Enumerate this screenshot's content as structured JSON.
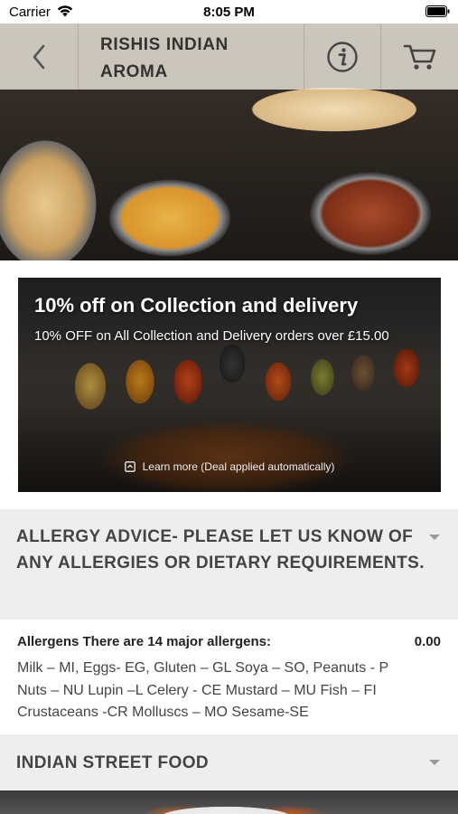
{
  "status_bar": {
    "carrier": "Carrier",
    "time": "8:05 PM"
  },
  "header": {
    "title": "RISHIS INDIAN AROMA"
  },
  "promo": {
    "title": "10% off on Collection and delivery",
    "description": "10% OFF on All Collection and Delivery orders over £15.00",
    "learn_more": "Learn more (Deal applied automatically)"
  },
  "categories": [
    {
      "title": "ALLERGY ADVICE- PLEASE LET US KNOW OF ANY ALLERGIES OR DIETARY REQUIREMENTS."
    },
    {
      "title": "INDIAN STREET FOOD"
    }
  ],
  "menu_item": {
    "name": "Allergens There are 14 major allergens:",
    "price": "0.00",
    "description": "Milk – MI, Eggs- EG, Gluten – GL Soya – SO, Peanuts - P Nuts – NU Lupin –L Celery - CE Mustard – MU Fish – FI Crustaceans -CR Molluscs – MO Sesame-SE"
  },
  "icons": {
    "back": "chevron-left-icon",
    "info": "info-icon",
    "cart": "cart-icon",
    "learn_more": "deal-icon",
    "expand": "chevron-down-icon"
  }
}
